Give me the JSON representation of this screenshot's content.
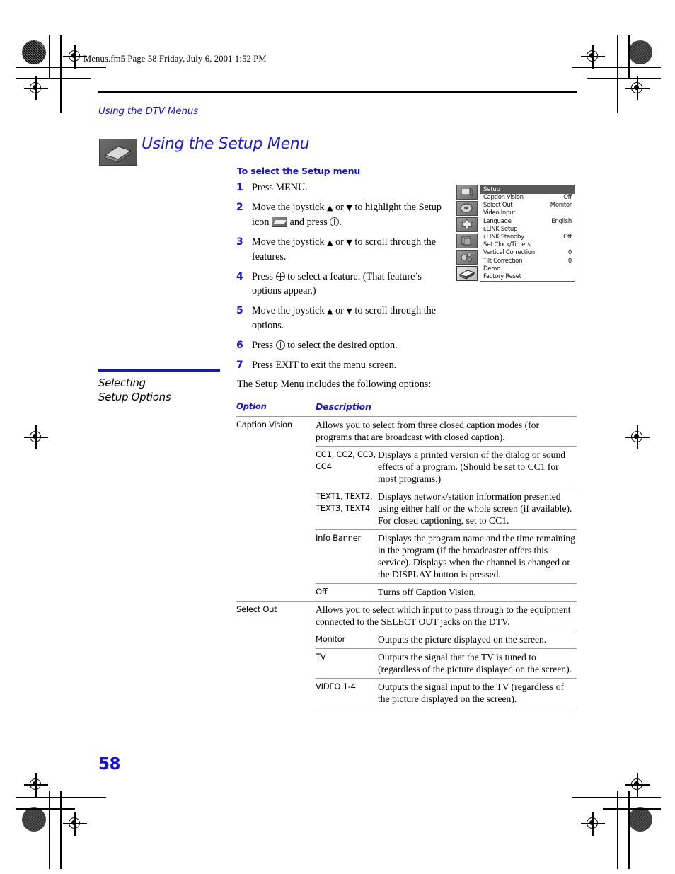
{
  "print_marks": {
    "fm_header": "Menus.fm5  Page 58  Friday, July 6, 2001  1:52 PM"
  },
  "running_head": "Using the DTV Menus",
  "section": {
    "icon_name": "setup-menu-icon",
    "title": "Using the Setup Menu",
    "subhead": "To select the Setup menu"
  },
  "steps": [
    {
      "num": "1",
      "html": "Press MENU."
    },
    {
      "num": "2",
      "html": "Move the joystick &#9650; or &#9660; to highlight the Setup icon &#9632; and press &#9678;."
    },
    {
      "num": "3",
      "html": "Move the joystick &#9650; or &#9660; to scroll through the features."
    },
    {
      "num": "4",
      "html": "Press &#9678; to select a feature. (That feature&rsquo;s options appear.)"
    },
    {
      "num": "5",
      "html": "Move the joystick &#9650; or &#9660; to scroll through the options."
    },
    {
      "num": "6",
      "html": "Press &#9678; to select the desired option."
    },
    {
      "num": "7",
      "html": "Press EXIT to exit the menu screen."
    }
  ],
  "osd": {
    "title": "Setup",
    "icons": [
      "video-input-icon",
      "audio-icon",
      "channel-icon",
      "parental-icon",
      "screen-icon",
      "setup-icon"
    ],
    "selected_icon_index": 5,
    "rows": [
      {
        "label": "Caption Vision",
        "value": "Off"
      },
      {
        "label": "Select Out",
        "value": "Monitor"
      },
      {
        "label": "Video Input",
        "value": ""
      },
      {
        "label": "Language",
        "value": "English"
      },
      {
        "label": "i.LINK Setup",
        "value": ""
      },
      {
        "label": "i.LINK Standby",
        "value": "Off"
      },
      {
        "label": "Set Clock/Timers",
        "value": ""
      },
      {
        "label": "Vertical Correction",
        "value": "0"
      },
      {
        "label": "Tilt Correction",
        "value": "0"
      },
      {
        "label": "Demo",
        "value": ""
      },
      {
        "label": "Factory Reset",
        "value": ""
      }
    ]
  },
  "side_heading": {
    "line1": "Selecting",
    "line2": "Setup Options"
  },
  "intro": "The Setup Menu includes the following options:",
  "table": {
    "headers": {
      "option": "Option",
      "description": "Description"
    },
    "rows": [
      {
        "option": "Caption Vision",
        "sub": "",
        "description": "Allows you to select from three closed caption modes (for programs that are broadcast with closed caption)."
      },
      {
        "option": "",
        "sub": "CC1, CC2, CC3, CC4",
        "description": "Displays a printed version of the dialog or sound effects of a program. (Should be set to CC1 for most programs.)"
      },
      {
        "option": "",
        "sub": "TEXT1, TEXT2, TEXT3, TEXT4",
        "description": "Displays network/station information presented using either half or the whole screen (if available). For closed captioning, set to CC1."
      },
      {
        "option": "",
        "sub": "Info Banner",
        "description": "Displays the program name and the time remaining in the program (if the broadcaster offers this service). Displays when the channel is changed or the DISPLAY button is pressed."
      },
      {
        "option": "",
        "sub": "Off",
        "description": "Turns off Caption Vision."
      },
      {
        "option": "Select Out",
        "sub": "",
        "description": "Allows you to select which input to pass through to the equipment connected to the SELECT OUT jacks on the DTV."
      },
      {
        "option": "",
        "sub": "Monitor",
        "description": "Outputs the picture displayed on the screen."
      },
      {
        "option": "",
        "sub": "TV",
        "description": "Outputs the signal that the TV is tuned to (regardless of the picture displayed on the screen)."
      },
      {
        "option": "",
        "sub": "VIDEO 1-4",
        "description": "Outputs the signal input to the TV (regardless of the picture displayed on the screen)."
      }
    ]
  },
  "page_number": "58",
  "colors": {
    "accent_blue": "#1414d2",
    "rule_black": "#000000",
    "table_line": "#9a9a9a"
  }
}
